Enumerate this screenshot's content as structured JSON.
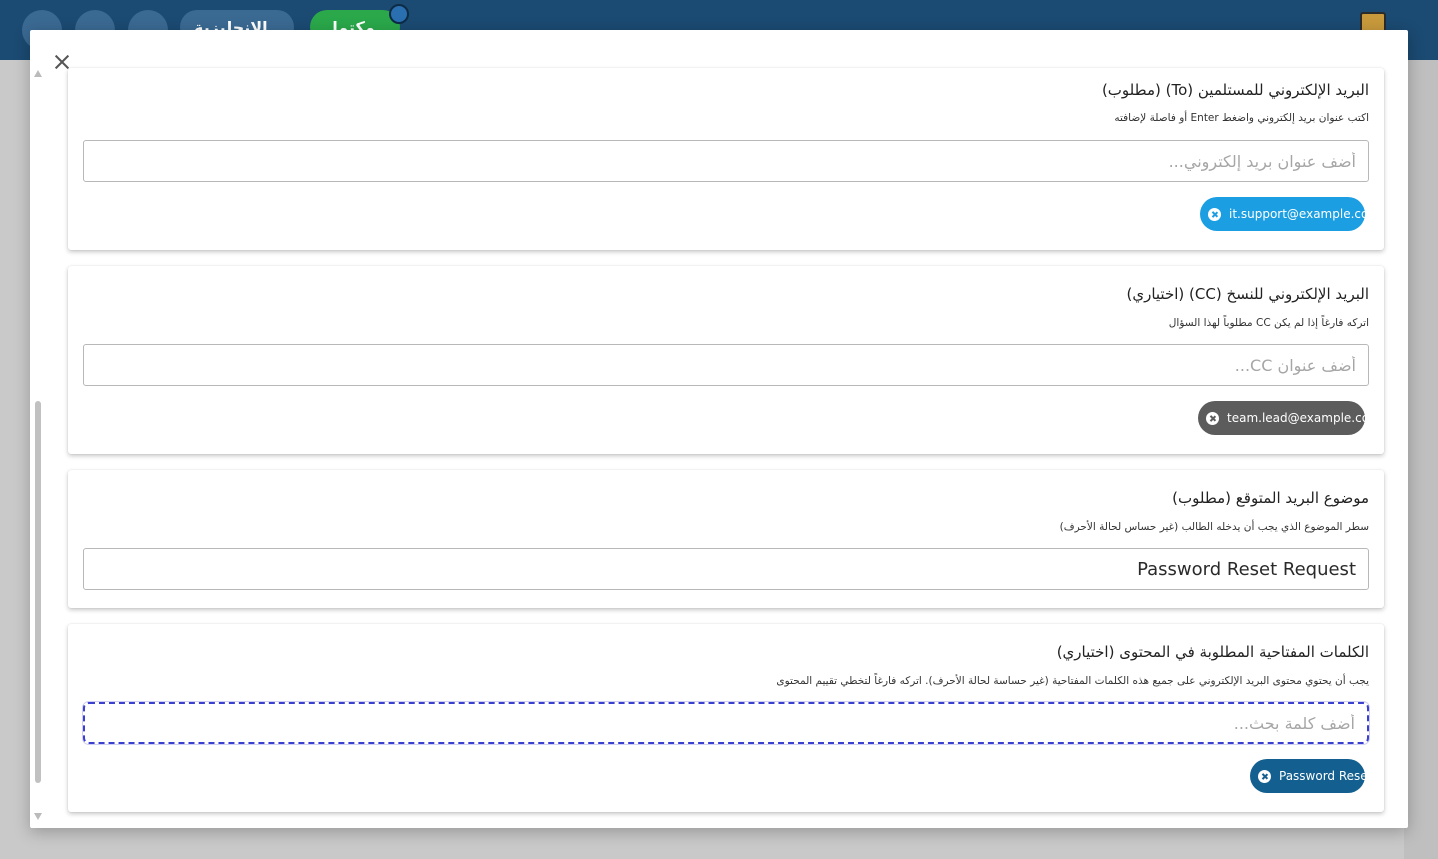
{
  "background": {
    "lang_button": "الإنجليزية",
    "status_button": "مكتمل"
  },
  "modal": {
    "to_section": {
      "title": "البريد الإلكتروني للمستلمين (To) (مطلوب)",
      "hint": "اكتب عنوان بريد إلكتروني واضغط Enter أو فاصلة لإضافته",
      "placeholder": "أضف عنوان بريد إلكتروني...",
      "chips": [
        "it.support@example.com"
      ]
    },
    "cc_section": {
      "title": "البريد الإلكتروني للنسخ (CC) (اختياري)",
      "hint": "اتركه فارغاً إذا لم يكن CC مطلوباً لهذا السؤال",
      "placeholder": "أضف عنوان CC...",
      "chips": [
        "team.lead@example.com"
      ]
    },
    "subject_section": {
      "title": "موضوع البريد المتوقع (مطلوب)",
      "hint": "سطر الموضوع الذي يجب أن يدخله الطالب (غير حساس لحالة الأحرف)",
      "value": "Password Reset Request"
    },
    "keywords_section": {
      "title": "الكلمات المفتاحية المطلوبة في المحتوى (اختياري)",
      "hint": "يجب أن يحتوي محتوى البريد الإلكتروني على جميع هذه الكلمات المفتاحية (غير حساسة لحالة الأحرف). اتركه فارغاً لتخطي تقييم المحتوى",
      "placeholder": "أضف كلمة بحث...",
      "chips": [
        "Password Reset"
      ]
    }
  },
  "colors": {
    "header_bg": "#1b4a72",
    "to_chip": "#1b9ee2",
    "cc_chip": "#5c5c5c",
    "keyword_chip": "#135f8f",
    "focus_ring": "#3a3fd0"
  },
  "icons": {
    "close": "close-icon",
    "chip_remove": "x-circle-icon"
  }
}
